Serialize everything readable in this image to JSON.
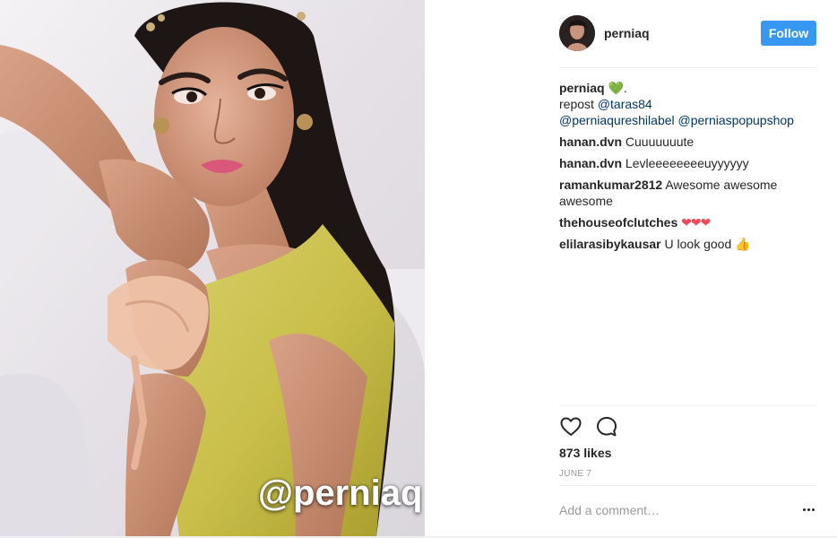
{
  "post": {
    "username": "perniaq",
    "follow_label": "Follow",
    "watermark": "@perniaq",
    "caption": {
      "user": "perniaq",
      "emoji": "💚",
      "line1_prefix": "repost",
      "line1_mention": "@taras84",
      "line2_mention1": "@perniaqureshilabel",
      "line2_mention2": "@perniaspopupshop"
    },
    "comments": [
      {
        "user": "hanan.dvn",
        "text": "Cuuuuuuute"
      },
      {
        "user": "hanan.dvn",
        "text": "Levleeeeeeeeuyyyyyy"
      },
      {
        "user": "ramankumar2812",
        "text": "Awesome awesome awesome"
      },
      {
        "user": "thehouseofclutches",
        "text": "",
        "emoji": "❤❤❤"
      },
      {
        "user": "elilarasibykausar",
        "text": "U look good",
        "emoji": "👍"
      }
    ],
    "likes": "873 likes",
    "date": "JUNE 7",
    "add_comment_placeholder": "Add a comment…",
    "icons": [
      "heart-icon",
      "comment-icon",
      "more-options-icon"
    ],
    "colors": {
      "follow_button": "#3897f0",
      "mention": "#003569",
      "muted": "#999999",
      "divider": "#efefef"
    }
  }
}
